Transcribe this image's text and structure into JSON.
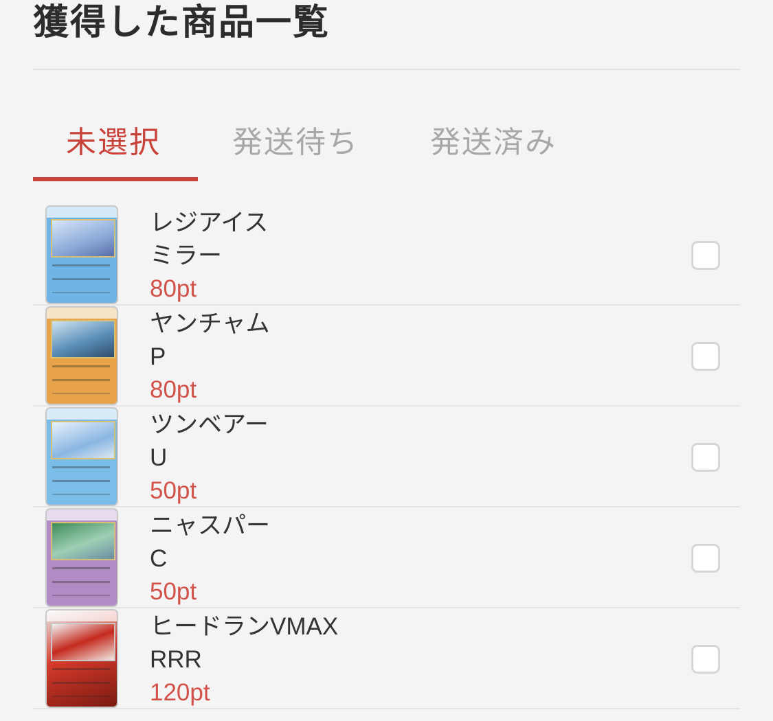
{
  "page": {
    "title": "獲得した商品一覧"
  },
  "tabs": [
    {
      "label": "未選択",
      "active": true
    },
    {
      "label": "発送待ち",
      "active": false
    },
    {
      "label": "発送済み",
      "active": false
    }
  ],
  "colors": {
    "accent": "#c8423a",
    "points": "#d2524a",
    "inactive_tab": "#a8a8a8",
    "background": "#f4f4f4"
  },
  "items": [
    {
      "name": "レジアイス",
      "rarity": "ミラー",
      "points": "80pt",
      "checked": false,
      "card_type": "water"
    },
    {
      "name": "ヤンチャム",
      "rarity": "P",
      "points": "80pt",
      "checked": false,
      "card_type": "fighting"
    },
    {
      "name": "ツンベアー",
      "rarity": "U",
      "points": "50pt",
      "checked": false,
      "card_type": "water"
    },
    {
      "name": "ニャスパー",
      "rarity": "C",
      "points": "50pt",
      "checked": false,
      "card_type": "psychic"
    },
    {
      "name": "ヒードランVMAX",
      "rarity": "RRR",
      "points": "120pt",
      "checked": false,
      "card_type": "fire"
    }
  ]
}
